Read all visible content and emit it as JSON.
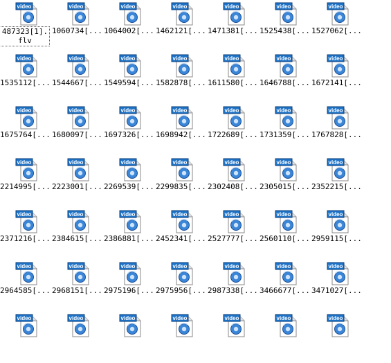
{
  "files": [
    "487323[1].flv",
    "1060734[...",
    "1064002[...",
    "1462121[...",
    "1471381[...",
    "1525438[...",
    "1527062[...",
    "1535112[...",
    "1544667[...",
    "1549594[...",
    "1582878[...",
    "1611580[...",
    "1646788[...",
    "1672141[...",
    "1675764[...",
    "1680097[...",
    "1697326[...",
    "1698942[...",
    "1722689[...",
    "1731359[...",
    "1767828[...",
    "2214995[...",
    "2223001[...",
    "2269539[...",
    "2299835[...",
    "2302408[...",
    "2305015[...",
    "2352215[...",
    "2371216[...",
    "2384615[...",
    "2386881[...",
    "2452341[...",
    "2527777[...",
    "2560110[...",
    "2959115[...",
    "2964585[...",
    "2968151[...",
    "2975196[...",
    "2975956[...",
    "2987338[...",
    "3466677[...",
    "3471027[...",
    "",
    "",
    "",
    "",
    "",
    "",
    ""
  ],
  "icon_badge": "video",
  "icon_name": "video-file-icon",
  "colors": {
    "badge": "#1e73c8",
    "disc": "#3a86d8",
    "page": "#ffffff"
  }
}
